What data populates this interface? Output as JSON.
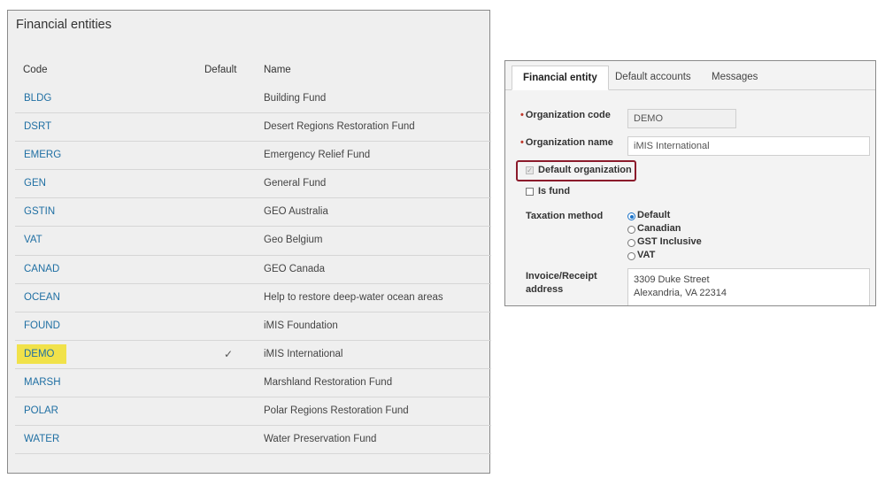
{
  "entities_panel": {
    "title": "Financial entities",
    "columns": {
      "code": "Code",
      "default": "Default",
      "name": "Name"
    },
    "rows": [
      {
        "code": "BLDG",
        "default": "",
        "name": "Building Fund"
      },
      {
        "code": "DSRT",
        "default": "",
        "name": "Desert Regions Restoration Fund"
      },
      {
        "code": "EMERG",
        "default": "",
        "name": "Emergency Relief Fund"
      },
      {
        "code": "GEN",
        "default": "",
        "name": "General Fund"
      },
      {
        "code": "GSTIN",
        "default": "",
        "name": "GEO Australia"
      },
      {
        "code": "VAT",
        "default": "",
        "name": "Geo Belgium"
      },
      {
        "code": "CANAD",
        "default": "",
        "name": "GEO Canada"
      },
      {
        "code": "OCEAN",
        "default": "",
        "name": "Help to restore deep-water ocean areas"
      },
      {
        "code": "FOUND",
        "default": "",
        "name": "iMIS Foundation"
      },
      {
        "code": "DEMO",
        "default": "✓",
        "name": "iMIS International"
      },
      {
        "code": "MARSH",
        "default": "",
        "name": "Marshland Restoration Fund"
      },
      {
        "code": "POLAR",
        "default": "",
        "name": "Polar Regions Restoration Fund"
      },
      {
        "code": "WATER",
        "default": "",
        "name": "Water Preservation Fund"
      }
    ],
    "highlight_color": "#f1e24a"
  },
  "entity_form": {
    "tabs": [
      {
        "label": "Financial entity",
        "active": true
      },
      {
        "label": "Default accounts",
        "active": false
      },
      {
        "label": "Messages",
        "active": false
      }
    ],
    "org_code_label": "Organization code",
    "org_code_value": "DEMO",
    "org_name_label": "Organization name",
    "org_name_value": "iMIS International",
    "default_org_label": "Default organization",
    "is_fund_label": "Is fund",
    "taxation_label": "Taxation method",
    "taxation_options": [
      "Default",
      "Canadian",
      "GST Inclusive",
      "VAT"
    ],
    "taxation_selected": "Default",
    "address_label": "Invoice/Receipt address",
    "address_line1": "3309 Duke Street",
    "address_line2": "Alexandria, VA 22314",
    "required_marker": "•",
    "accent_color": "#8b1a2b",
    "link_color": "#1f6fa3"
  }
}
